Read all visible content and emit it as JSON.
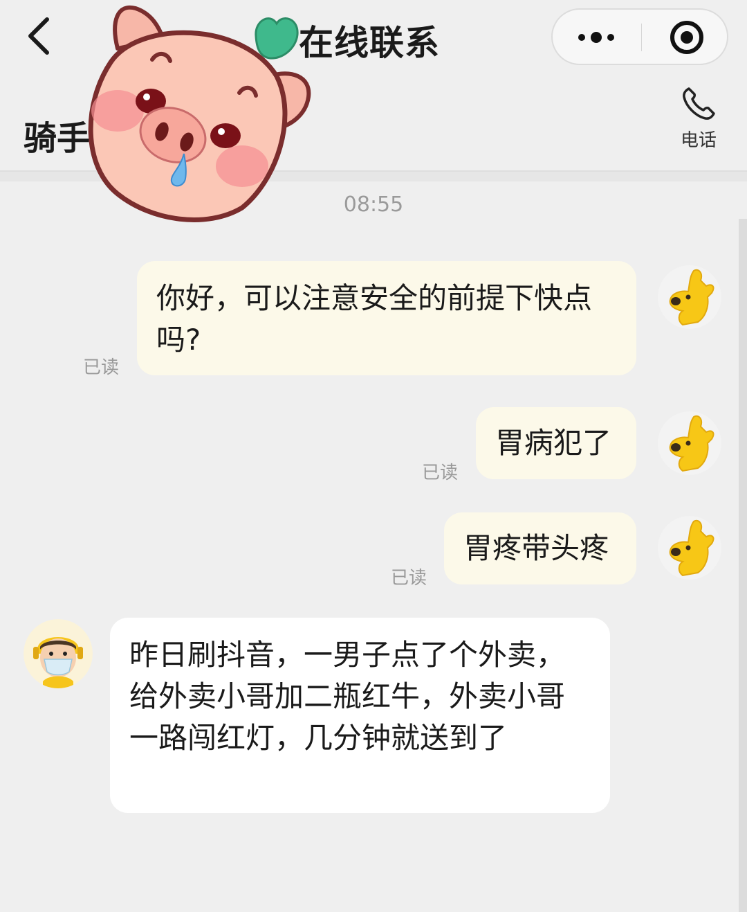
{
  "header": {
    "title": "在线联系"
  },
  "subheader": {
    "rider_label": "骑手",
    "phone_label": "电话"
  },
  "timestamp": "08:55",
  "messages": [
    {
      "from": "me",
      "text": "你好，可以注意安全的前提下快点吗?",
      "status": "已读"
    },
    {
      "from": "me",
      "text": "胃病犯了",
      "status": "已读"
    },
    {
      "from": "me",
      "text": "胃疼带头疼",
      "status": "已读"
    },
    {
      "from": "rider",
      "text": "昨日刷抖音，一男子点了个外卖，给外卖小哥加二瓶红牛，外卖小哥一路闯红灯，几分钟就送到了"
    }
  ],
  "colors": {
    "my_bubble": "#fcf9e9",
    "rider_bubble": "#ffffff",
    "background": "#efefef",
    "kangaroo": "#f7c716"
  }
}
